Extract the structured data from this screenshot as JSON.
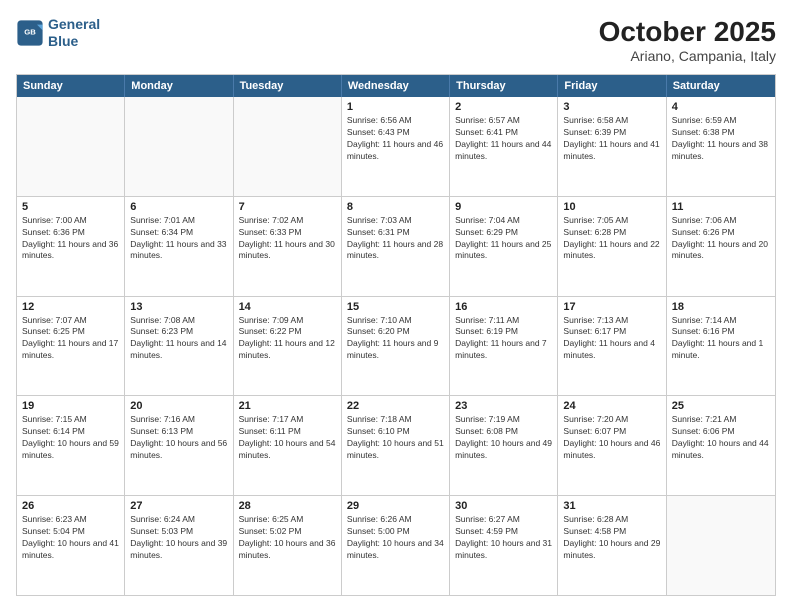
{
  "header": {
    "logo_line1": "General",
    "logo_line2": "Blue",
    "month_title": "October 2025",
    "location": "Ariano, Campania, Italy"
  },
  "days_of_week": [
    "Sunday",
    "Monday",
    "Tuesday",
    "Wednesday",
    "Thursday",
    "Friday",
    "Saturday"
  ],
  "weeks": [
    [
      {
        "day": "",
        "info": ""
      },
      {
        "day": "",
        "info": ""
      },
      {
        "day": "",
        "info": ""
      },
      {
        "day": "1",
        "info": "Sunrise: 6:56 AM\nSunset: 6:43 PM\nDaylight: 11 hours and 46 minutes."
      },
      {
        "day": "2",
        "info": "Sunrise: 6:57 AM\nSunset: 6:41 PM\nDaylight: 11 hours and 44 minutes."
      },
      {
        "day": "3",
        "info": "Sunrise: 6:58 AM\nSunset: 6:39 PM\nDaylight: 11 hours and 41 minutes."
      },
      {
        "day": "4",
        "info": "Sunrise: 6:59 AM\nSunset: 6:38 PM\nDaylight: 11 hours and 38 minutes."
      }
    ],
    [
      {
        "day": "5",
        "info": "Sunrise: 7:00 AM\nSunset: 6:36 PM\nDaylight: 11 hours and 36 minutes."
      },
      {
        "day": "6",
        "info": "Sunrise: 7:01 AM\nSunset: 6:34 PM\nDaylight: 11 hours and 33 minutes."
      },
      {
        "day": "7",
        "info": "Sunrise: 7:02 AM\nSunset: 6:33 PM\nDaylight: 11 hours and 30 minutes."
      },
      {
        "day": "8",
        "info": "Sunrise: 7:03 AM\nSunset: 6:31 PM\nDaylight: 11 hours and 28 minutes."
      },
      {
        "day": "9",
        "info": "Sunrise: 7:04 AM\nSunset: 6:29 PM\nDaylight: 11 hours and 25 minutes."
      },
      {
        "day": "10",
        "info": "Sunrise: 7:05 AM\nSunset: 6:28 PM\nDaylight: 11 hours and 22 minutes."
      },
      {
        "day": "11",
        "info": "Sunrise: 7:06 AM\nSunset: 6:26 PM\nDaylight: 11 hours and 20 minutes."
      }
    ],
    [
      {
        "day": "12",
        "info": "Sunrise: 7:07 AM\nSunset: 6:25 PM\nDaylight: 11 hours and 17 minutes."
      },
      {
        "day": "13",
        "info": "Sunrise: 7:08 AM\nSunset: 6:23 PM\nDaylight: 11 hours and 14 minutes."
      },
      {
        "day": "14",
        "info": "Sunrise: 7:09 AM\nSunset: 6:22 PM\nDaylight: 11 hours and 12 minutes."
      },
      {
        "day": "15",
        "info": "Sunrise: 7:10 AM\nSunset: 6:20 PM\nDaylight: 11 hours and 9 minutes."
      },
      {
        "day": "16",
        "info": "Sunrise: 7:11 AM\nSunset: 6:19 PM\nDaylight: 11 hours and 7 minutes."
      },
      {
        "day": "17",
        "info": "Sunrise: 7:13 AM\nSunset: 6:17 PM\nDaylight: 11 hours and 4 minutes."
      },
      {
        "day": "18",
        "info": "Sunrise: 7:14 AM\nSunset: 6:16 PM\nDaylight: 11 hours and 1 minute."
      }
    ],
    [
      {
        "day": "19",
        "info": "Sunrise: 7:15 AM\nSunset: 6:14 PM\nDaylight: 10 hours and 59 minutes."
      },
      {
        "day": "20",
        "info": "Sunrise: 7:16 AM\nSunset: 6:13 PM\nDaylight: 10 hours and 56 minutes."
      },
      {
        "day": "21",
        "info": "Sunrise: 7:17 AM\nSunset: 6:11 PM\nDaylight: 10 hours and 54 minutes."
      },
      {
        "day": "22",
        "info": "Sunrise: 7:18 AM\nSunset: 6:10 PM\nDaylight: 10 hours and 51 minutes."
      },
      {
        "day": "23",
        "info": "Sunrise: 7:19 AM\nSunset: 6:08 PM\nDaylight: 10 hours and 49 minutes."
      },
      {
        "day": "24",
        "info": "Sunrise: 7:20 AM\nSunset: 6:07 PM\nDaylight: 10 hours and 46 minutes."
      },
      {
        "day": "25",
        "info": "Sunrise: 7:21 AM\nSunset: 6:06 PM\nDaylight: 10 hours and 44 minutes."
      }
    ],
    [
      {
        "day": "26",
        "info": "Sunrise: 6:23 AM\nSunset: 5:04 PM\nDaylight: 10 hours and 41 minutes."
      },
      {
        "day": "27",
        "info": "Sunrise: 6:24 AM\nSunset: 5:03 PM\nDaylight: 10 hours and 39 minutes."
      },
      {
        "day": "28",
        "info": "Sunrise: 6:25 AM\nSunset: 5:02 PM\nDaylight: 10 hours and 36 minutes."
      },
      {
        "day": "29",
        "info": "Sunrise: 6:26 AM\nSunset: 5:00 PM\nDaylight: 10 hours and 34 minutes."
      },
      {
        "day": "30",
        "info": "Sunrise: 6:27 AM\nSunset: 4:59 PM\nDaylight: 10 hours and 31 minutes."
      },
      {
        "day": "31",
        "info": "Sunrise: 6:28 AM\nSunset: 4:58 PM\nDaylight: 10 hours and 29 minutes."
      },
      {
        "day": "",
        "info": ""
      }
    ]
  ]
}
